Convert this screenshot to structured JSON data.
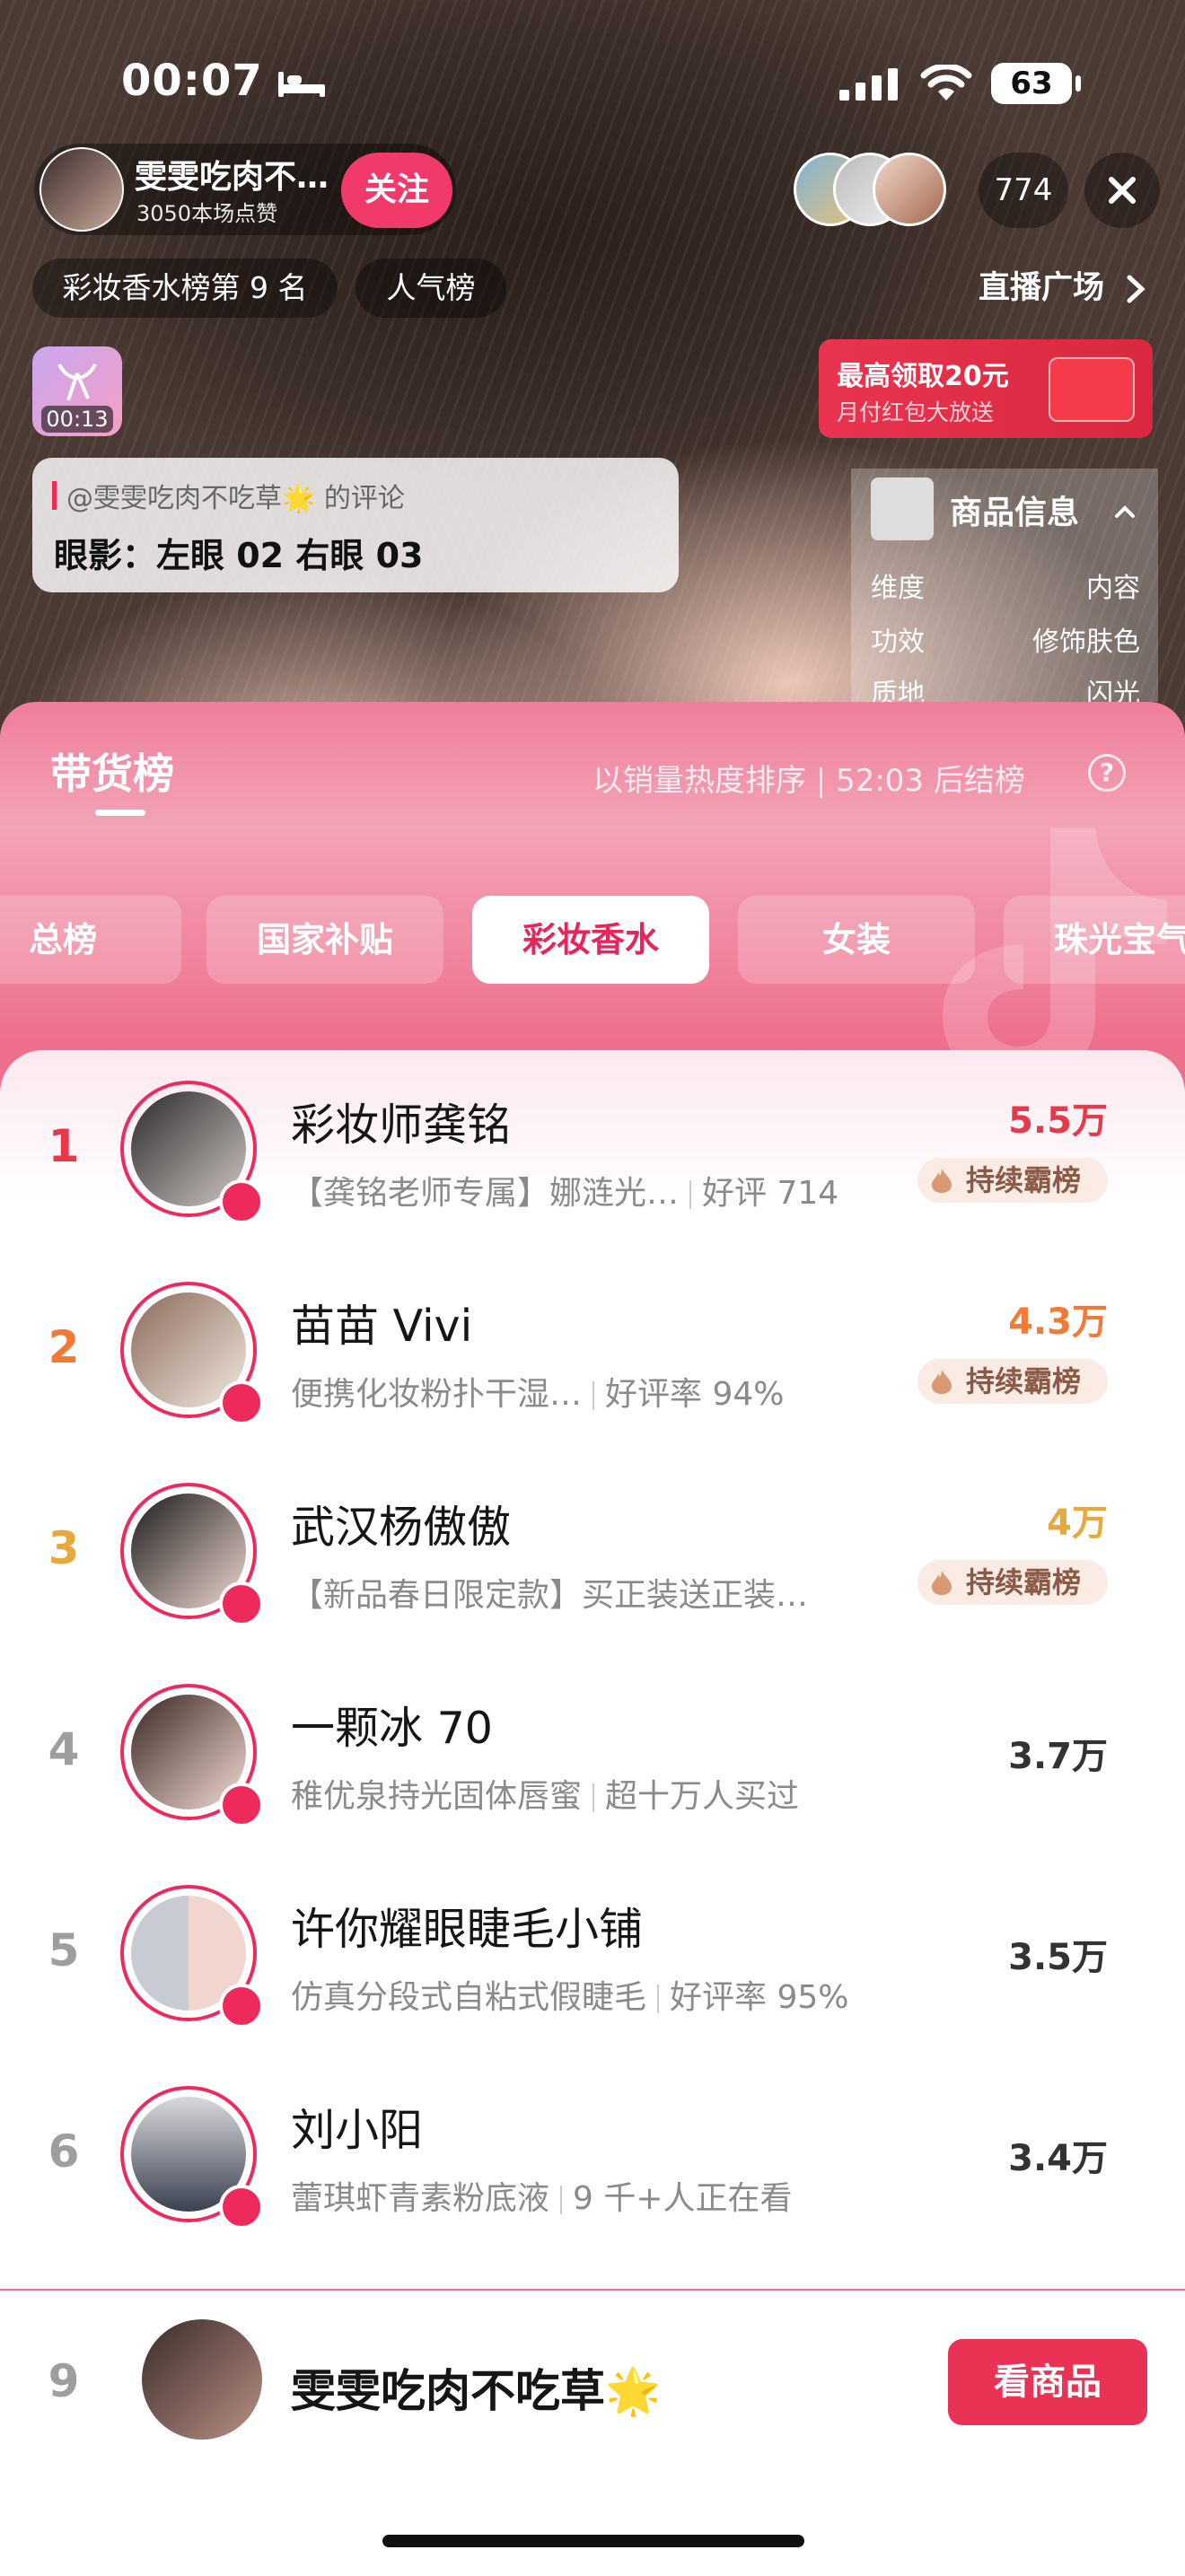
{
  "status_bar": {
    "time": "00:07",
    "battery": "63"
  },
  "stream_header": {
    "host_name": "雯雯吃肉不…",
    "likes": "3050本场点赞",
    "follow_label": "关注",
    "viewer_count": "774",
    "rank_label": "彩妆香水榜第 9 名",
    "popular_label": "人气榜",
    "square_label": "直播广场"
  },
  "gift": {
    "timer": "00:13"
  },
  "red_packet": {
    "title": "最高领取20元",
    "subtitle": "月付红包大放送"
  },
  "comment": {
    "author": "@雯雯吃肉不吃草🌟 的评论",
    "text": "眼影：左眼 02 右眼 03"
  },
  "product_info": {
    "title": "商品信息",
    "rows": [
      {
        "key": "维度",
        "value": "内容"
      },
      {
        "key": "功效",
        "value": "修饰肤色"
      },
      {
        "key": "质地",
        "value": "闪光"
      }
    ]
  },
  "board": {
    "title": "带货榜",
    "sort_text": "以销量热度排序 | 52:03 后结榜",
    "help": "?",
    "tabs": [
      "总榜",
      "国家补贴",
      "彩妆香水",
      "女装",
      "珠光宝气"
    ],
    "active_tab": "彩妆香水"
  },
  "colors": {
    "accent": "#EE2A5D",
    "rank1": "#E8394A",
    "rank2": "#F07A36",
    "rank3": "#E7A93A",
    "rank_other": "#9E9E9E"
  },
  "rankings": [
    {
      "rank": "1",
      "name": "彩妆师龚铭",
      "product": "【龚铭老师专属】娜涟光…",
      "meta": "好评 714",
      "amount": "5.5万",
      "badge": "持续霸榜"
    },
    {
      "rank": "2",
      "name": "苗苗 Vivi",
      "product": "便携化妆粉扑干湿…",
      "meta": "好评率 94%",
      "amount": "4.3万",
      "badge": "持续霸榜"
    },
    {
      "rank": "3",
      "name": "武汉杨傲傲",
      "product": "【新品春日限定款】买正装送正装…",
      "meta": "",
      "amount": "4万",
      "badge": "持续霸榜"
    },
    {
      "rank": "4",
      "name": "一颗冰 70",
      "product": "稚优泉持光固体唇蜜",
      "meta": "超十万人买过",
      "amount": "3.7万",
      "badge": ""
    },
    {
      "rank": "5",
      "name": "许你耀眼睫毛小铺",
      "product": "仿真分段式自粘式假睫毛",
      "meta": "好评率 95%",
      "amount": "3.5万",
      "badge": ""
    },
    {
      "rank": "6",
      "name": "刘小阳",
      "product": "蕾琪虾青素粉底液",
      "meta": "9 千+人正在看",
      "amount": "3.4万",
      "badge": ""
    }
  ],
  "my_rank": {
    "rank": "9",
    "name": "雯雯吃肉不吃草🌟",
    "button": "看商品"
  }
}
